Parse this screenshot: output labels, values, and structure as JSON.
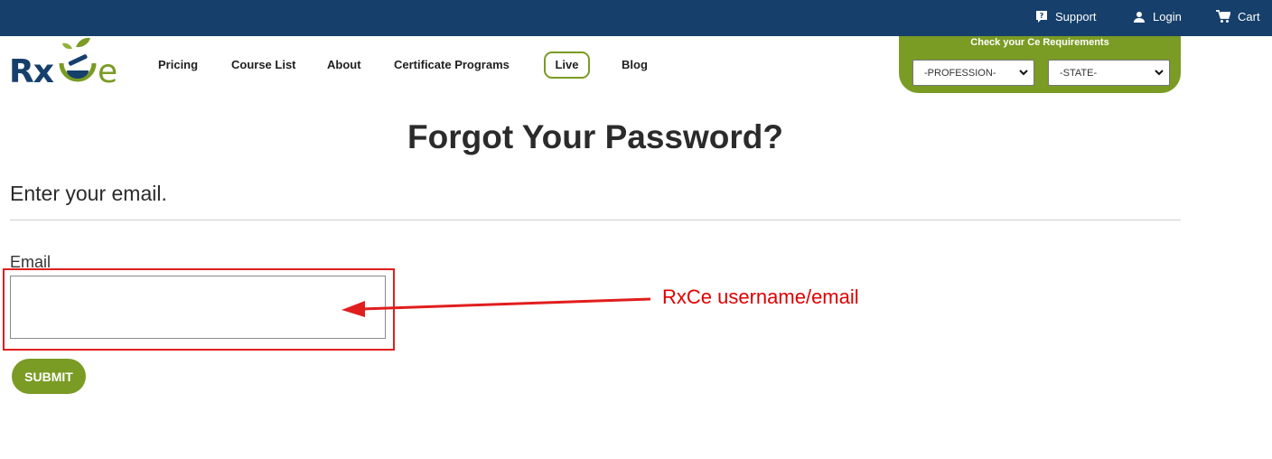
{
  "topbar": {
    "support_label": "Support",
    "login_label": "Login",
    "cart_label": "Cart",
    "background": "#163f6b"
  },
  "logo": {
    "text_rx": "Rx",
    "text_e": "e",
    "icon": "mortar-and-pestle-leaf-icon"
  },
  "nav": {
    "items": [
      {
        "label": "Pricing"
      },
      {
        "label": "Course List"
      },
      {
        "label": "About"
      },
      {
        "label": "Certificate Programs"
      },
      {
        "label": "Live"
      },
      {
        "label": "Blog"
      }
    ]
  },
  "requirements": {
    "title": "Check your Ce Requirements",
    "profession_value": "-PROFESSION-",
    "state_value": "-STATE-",
    "accent": "#7a9b24"
  },
  "page": {
    "title": "Forgot Your Password?",
    "subtitle": "Enter your email."
  },
  "form": {
    "email_label": "Email",
    "email_value": "",
    "submit_label": "SUBMIT"
  },
  "annotation": {
    "text": "RxCe username/email",
    "color": "#e00000"
  }
}
